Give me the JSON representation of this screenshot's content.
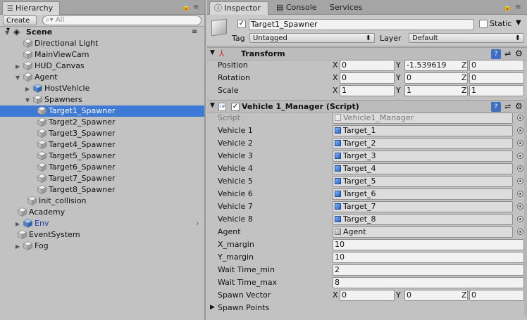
{
  "hierarchy": {
    "tab_label": "Hierarchy",
    "create_label": "Create",
    "search_placeholder": "All",
    "scene_name": "Scene",
    "items": [
      {
        "label": "Directional Light",
        "kind": "gray",
        "fold": ""
      },
      {
        "label": "MainViewCam",
        "kind": "gray",
        "fold": ""
      },
      {
        "label": "HUD_Canvas",
        "kind": "gray",
        "fold": "closed"
      },
      {
        "label": "Agent",
        "kind": "gray",
        "fold": "open"
      },
      {
        "label": "HostVehicle",
        "kind": "blue",
        "fold": "closed"
      },
      {
        "label": "Spawners",
        "kind": "gray",
        "fold": "open"
      },
      {
        "label": "Target1_Spawner",
        "kind": "gray",
        "fold": "",
        "selected": true
      },
      {
        "label": "Target2_Spawner",
        "kind": "gray",
        "fold": ""
      },
      {
        "label": "Target3_Spawner",
        "kind": "gray",
        "fold": ""
      },
      {
        "label": "Target4_Spawner",
        "kind": "gray",
        "fold": ""
      },
      {
        "label": "Target5_Spawner",
        "kind": "gray",
        "fold": ""
      },
      {
        "label": "Target6_Spawner",
        "kind": "gray",
        "fold": ""
      },
      {
        "label": "Target7_Spawner",
        "kind": "gray",
        "fold": ""
      },
      {
        "label": "Target8_Spawner",
        "kind": "gray",
        "fold": ""
      },
      {
        "label": "Init_collision",
        "kind": "gray",
        "fold": ""
      },
      {
        "label": "Academy",
        "kind": "gray",
        "fold": ""
      },
      {
        "label": "Env",
        "kind": "blue",
        "fold": "closed",
        "prefab": true
      },
      {
        "label": "EventSystem",
        "kind": "gray",
        "fold": ""
      },
      {
        "label": "Fog",
        "kind": "gray",
        "fold": "closed"
      }
    ]
  },
  "tabs": {
    "inspector": "Inspector",
    "console": "Console",
    "services": "Services"
  },
  "object": {
    "name": "Target1_Spawner",
    "static_label": "Static",
    "tag_label": "Tag",
    "tag_value": "Untagged",
    "layer_label": "Layer",
    "layer_value": "Default"
  },
  "transform": {
    "title": "Transform",
    "position_label": "Position",
    "rotation_label": "Rotation",
    "scale_label": "Scale",
    "position": {
      "x": "0",
      "y": "-1.539619",
      "z": "0"
    },
    "rotation": {
      "x": "0",
      "y": "0",
      "z": "0"
    },
    "scale": {
      "x": "1",
      "y": "1",
      "z": "1"
    }
  },
  "manager": {
    "title": "Vehicle 1_Manager (Script)",
    "script_label": "Script",
    "script_value": "Vehicle1_Manager",
    "vehicles": [
      {
        "label": "Vehicle 1",
        "value": "Target_1"
      },
      {
        "label": "Vehicle 2",
        "value": "Target_2"
      },
      {
        "label": "Vehicle 3",
        "value": "Target_3"
      },
      {
        "label": "Vehicle 4",
        "value": "Target_4"
      },
      {
        "label": "Vehicle 5",
        "value": "Target_5"
      },
      {
        "label": "Vehicle 6",
        "value": "Target_6"
      },
      {
        "label": "Vehicle 7",
        "value": "Target_7"
      },
      {
        "label": "Vehicle 8",
        "value": "Target_8"
      }
    ],
    "agent_label": "Agent",
    "agent_value": "Agent",
    "x_margin_label": "X_margin",
    "x_margin": "10",
    "y_margin_label": "Y_margin",
    "y_margin": "10",
    "wait_min_label": "Wait Time_min",
    "wait_min": "2",
    "wait_max_label": "Wait Time_max",
    "wait_max": "8",
    "spawn_vector_label": "Spawn Vector",
    "spawn_vector": {
      "x": "0",
      "y": "0",
      "z": "0"
    },
    "spawn_points_label": "Spawn Points"
  },
  "axis": {
    "x": "X",
    "y": "Y",
    "z": "Z"
  },
  "colors": {
    "selection": "#3d7ad5",
    "panel": "#c2c2c2",
    "prefab_text": "#1f3fb0"
  }
}
